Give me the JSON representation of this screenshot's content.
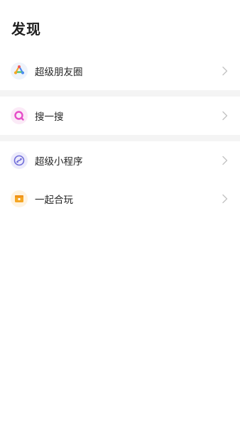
{
  "header": {
    "title": "发现"
  },
  "items": [
    {
      "label": "超级朋友圈",
      "icon": "friends-circle-icon"
    },
    {
      "label": "搜一搜",
      "icon": "search-icon"
    },
    {
      "label": "超级小程序",
      "icon": "mini-program-icon"
    },
    {
      "label": "一起合玩",
      "icon": "play-together-icon"
    }
  ],
  "colors": {
    "divider": "#f4f4f4",
    "search_accent": "#e64cc8",
    "mini_program_accent": "#6f6cd9",
    "play_accent": "#f5a623"
  }
}
